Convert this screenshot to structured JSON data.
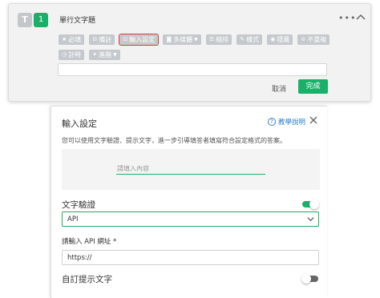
{
  "question_card": {
    "type_badge": "T",
    "number": "1",
    "title": "單行文字題",
    "more_icon": "ellipsis-icon",
    "collapse_icon": "chevron-up-icon",
    "tags": [
      {
        "icon": "★",
        "label": "必填",
        "active": false
      },
      {
        "icon": "⊟",
        "label": "備註",
        "active": false
      },
      {
        "icon": "⊡",
        "label": "輸入設定",
        "active": true
      },
      {
        "icon": "◙",
        "label": "多媒體",
        "active": false,
        "dropdown": true
      },
      {
        "icon": "☰",
        "label": "縮排",
        "active": false
      },
      {
        "icon": "✎",
        "label": "樣式",
        "active": false
      },
      {
        "icon": "◉",
        "label": "隱藏",
        "active": false
      },
      {
        "icon": "⊘",
        "label": "不重複",
        "active": false
      },
      {
        "icon": "◷",
        "label": "計時",
        "active": false
      },
      {
        "icon": "✦",
        "label": "進階",
        "active": false,
        "dropdown": true
      }
    ],
    "cancel_label": "取消",
    "done_label": "完成",
    "accent_color": "#1bb069",
    "highlight_color": "#d93a3a"
  },
  "settings_panel": {
    "title": "輸入設定",
    "help_label": "教學說明",
    "description": "您可以使用文字驗證、提示文字，進一步引導填答者填寫符合設定格式的答案。",
    "preview_placeholder": "請填入內容",
    "validation_label": "文字驗證",
    "validation_enabled": true,
    "validation_type": "API",
    "url_label": "請輸入 API 網址 *",
    "url_value": "https://",
    "custom_hint_label": "自訂提示文字",
    "custom_hint_enabled": false
  }
}
